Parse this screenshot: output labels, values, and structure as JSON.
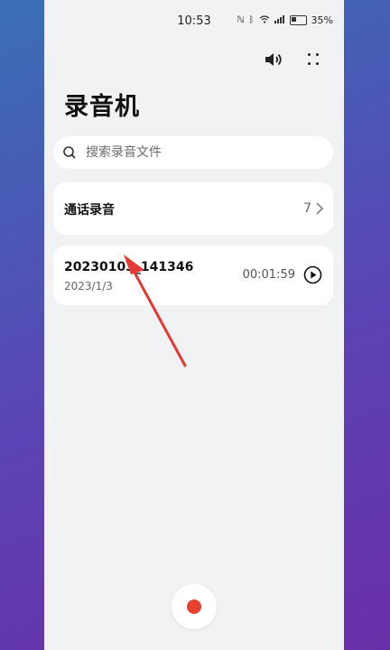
{
  "status_bar": {
    "time": "10:53",
    "battery_text": "35%",
    "battery_level": 0.35
  },
  "toolbar": {
    "speaker_icon": "speaker-icon",
    "more_icon": "more-dots-icon"
  },
  "page": {
    "title": "录音机"
  },
  "search": {
    "placeholder": "搜索录音文件",
    "value": ""
  },
  "call_recordings": {
    "label": "通话录音",
    "count": "7"
  },
  "recordings": [
    {
      "name": "20230103_141346",
      "date": "2023/1/3",
      "duration": "00:01:59"
    }
  ],
  "colors": {
    "record_button": "#e8402f",
    "annotation_arrow": "#e53935",
    "page_bg": "#f1f2f4"
  }
}
